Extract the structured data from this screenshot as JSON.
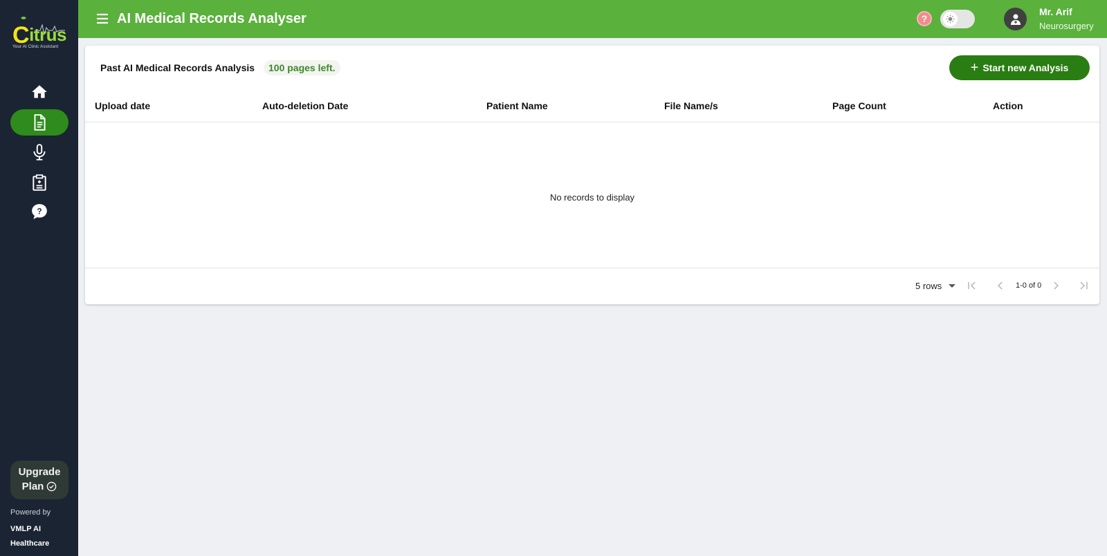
{
  "brand": {
    "logo_text_c": "C",
    "logo_text_rest": "itrus",
    "tagline": "Your AI Clinic Assistant",
    "accent_color": "#5ab13c",
    "sidebar_color": "#1b2433"
  },
  "sidebar": {
    "items": [
      {
        "name": "home",
        "icon": "home-icon",
        "active": false
      },
      {
        "name": "medical-records",
        "icon": "document-icon",
        "active": true
      },
      {
        "name": "dictation",
        "icon": "microphone-icon",
        "active": false
      },
      {
        "name": "clipboard",
        "icon": "clipboard-icon",
        "active": false
      },
      {
        "name": "help-chat",
        "icon": "question-chat-icon",
        "active": false
      }
    ],
    "upgrade_line1": "Upgrade",
    "upgrade_line2": "Plan",
    "powered_by": "Powered by",
    "company": "VMLP AI Healthcare"
  },
  "header": {
    "title": "AI Medical Records Analyser",
    "help": "?",
    "user_name": "Mr. Arif",
    "user_department": "Neurosurgery"
  },
  "main": {
    "card_title": "Past AI Medical Records Analysis",
    "pages_left": "100 pages left.",
    "start_button": "Start new Analysis",
    "columns": [
      "Upload date",
      "Auto-deletion Date",
      "Patient Name",
      "File Name/s",
      "Page Count",
      "Action"
    ],
    "rows": [],
    "empty_message": "No records to display",
    "pagination": {
      "rows_per_page": "5 rows",
      "range": "1-0 of 0"
    }
  }
}
